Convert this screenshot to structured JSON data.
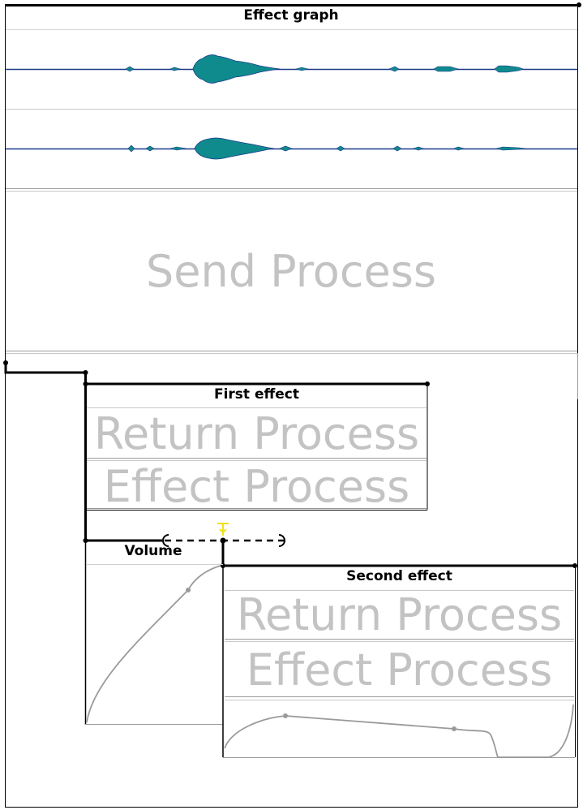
{
  "graph": {
    "title": "Effect graph",
    "send_process_label": "Send Process"
  },
  "first_effect": {
    "title": "First effect",
    "return_label": "Return Process",
    "effect_label": "Effect Process"
  },
  "volume": {
    "title": "Volume"
  },
  "second_effect": {
    "title": "Second effect",
    "return_label": "Return Process",
    "effect_label": "Effect Process"
  },
  "colors": {
    "waveform_fill": "#0f8b8d",
    "waveform_line": "#1d3b8c",
    "connection_line": "#000000",
    "curve": "#9a9a9a",
    "label_gray": "#c3c3c3",
    "port_marker": "#f2e019"
  }
}
